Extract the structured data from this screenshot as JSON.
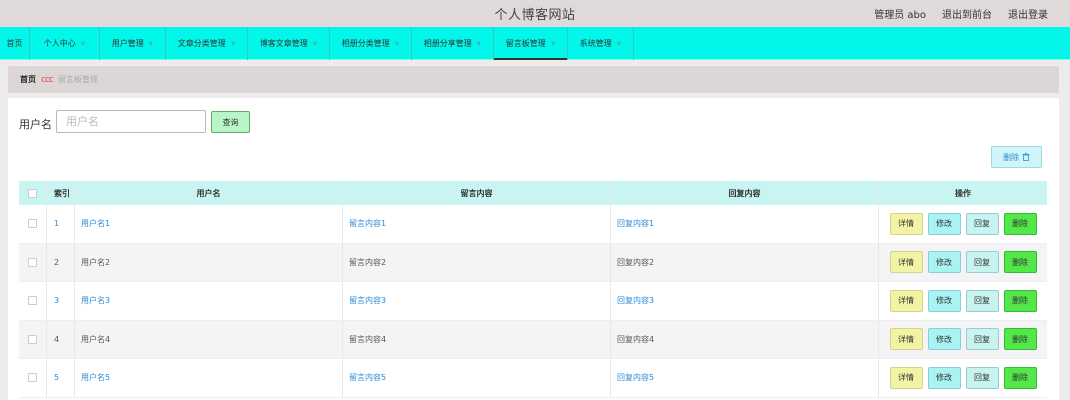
{
  "header": {
    "site_title": "个人博客网站",
    "admin_label": "管理员 abo",
    "to_front": "退出到前台",
    "logout": "退出登录"
  },
  "nav": [
    {
      "label": "首页",
      "dropdown": false,
      "active": false
    },
    {
      "label": "个人中心",
      "dropdown": true,
      "active": false
    },
    {
      "label": "用户管理",
      "dropdown": true,
      "active": false
    },
    {
      "label": "文章分类管理",
      "dropdown": true,
      "active": false
    },
    {
      "label": "博客文章管理",
      "dropdown": true,
      "active": false
    },
    {
      "label": "相册分类管理",
      "dropdown": true,
      "active": false
    },
    {
      "label": "相册分享管理",
      "dropdown": true,
      "active": false
    },
    {
      "label": "留言板管理",
      "dropdown": true,
      "active": true
    },
    {
      "label": "系统管理",
      "dropdown": true,
      "active": false
    }
  ],
  "breadcrumb": {
    "home": "首页",
    "separator": "ccc",
    "current": "留言板管理"
  },
  "search": {
    "label": "用户名",
    "placeholder": "用户名",
    "value": "",
    "button": "查询"
  },
  "toolbar": {
    "delete_label": "删除",
    "delete_icon": "trash-icon"
  },
  "table": {
    "headers": [
      "索引",
      "用户名",
      "留言内容",
      "回复内容",
      "操作"
    ],
    "rows": [
      {
        "index": "1",
        "username": "用户名1",
        "message": "留言内容1",
        "reply": "回复内容1"
      },
      {
        "index": "2",
        "username": "用户名2",
        "message": "留言内容2",
        "reply": "回复内容2"
      },
      {
        "index": "3",
        "username": "用户名3",
        "message": "留言内容3",
        "reply": "回复内容3"
      },
      {
        "index": "4",
        "username": "用户名4",
        "message": "留言内容4",
        "reply": "回复内容4"
      },
      {
        "index": "5",
        "username": "用户名5",
        "message": "留言内容5",
        "reply": "回复内容5"
      }
    ],
    "actions": {
      "detail": "详情",
      "edit": "修改",
      "reply": "回复",
      "delete": "删除"
    }
  },
  "colors": {
    "navbar": "#00f7ea",
    "topbar": "#e0d9d9",
    "table_header": "#c8f4f1",
    "link_blue": "#2b8ad8",
    "delete_green": "#52e84a"
  }
}
